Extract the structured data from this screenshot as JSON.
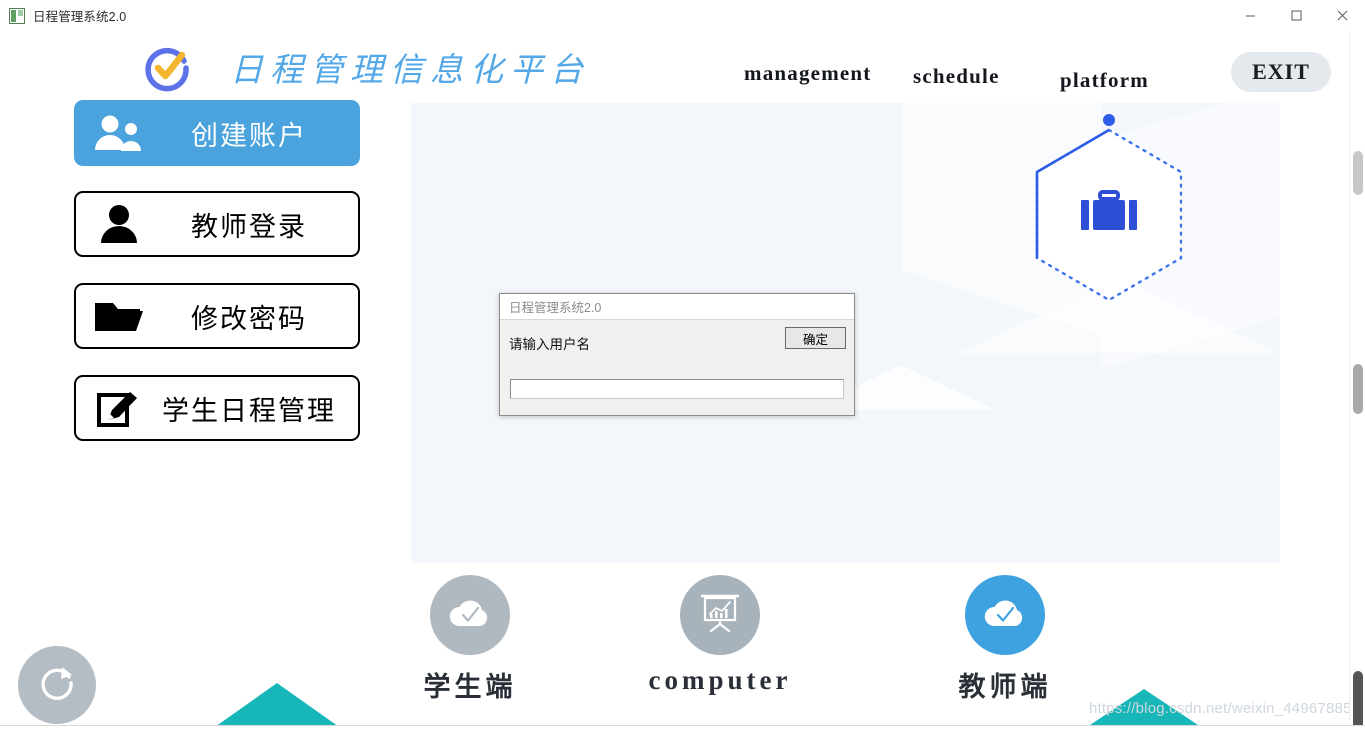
{
  "window": {
    "title": "日程管理系统2.0",
    "app_icon": "app-window-icon",
    "minimize_label": "minimize-icon",
    "maximize_label": "maximize-icon",
    "close_label": "close-icon"
  },
  "header": {
    "logo_icon": "circle-check-logo-icon",
    "brand_title": "日程管理信息化平台",
    "nav": [
      {
        "label": "management"
      },
      {
        "label": "schedule"
      },
      {
        "label": "platform"
      }
    ],
    "exit_label": "EXIT"
  },
  "sidebar": {
    "items": [
      {
        "label": "创建账户",
        "icon": "two-users-icon",
        "active": true
      },
      {
        "label": "教师登录",
        "icon": "user-icon",
        "active": false
      },
      {
        "label": "修改密码",
        "icon": "folder-icon",
        "active": false
      },
      {
        "label": "学生日程管理",
        "icon": "edit-pencil-icon",
        "active": false
      }
    ]
  },
  "main": {
    "hex_icon": "briefcase-icon",
    "hex_dot": "node-dot"
  },
  "dialog": {
    "title": "日程管理系统2.0",
    "message": "请输入用户名",
    "ok_label": "确定",
    "input_value": "",
    "input_placeholder": ""
  },
  "features": [
    {
      "label": "学生端",
      "icon": "cloud-check-icon",
      "color": "#b0b8c0"
    },
    {
      "label": "computer",
      "icon": "presentation-chart-icon",
      "color": "#a8b2ba"
    },
    {
      "label": "教师端",
      "icon": "cloud-check-icon",
      "color": "#3fa2e0"
    }
  ],
  "footer": {
    "refresh_icon": "refresh-icon",
    "watermark": "https://blog.csdn.net/weixin_44967885"
  },
  "colors": {
    "accent_blue": "#4aa3dc",
    "brand_text": "#54a8e8",
    "panel_bg": "#f3f6fb",
    "teal": "#17b7b9",
    "hex_blue": "#2d5ce8"
  }
}
